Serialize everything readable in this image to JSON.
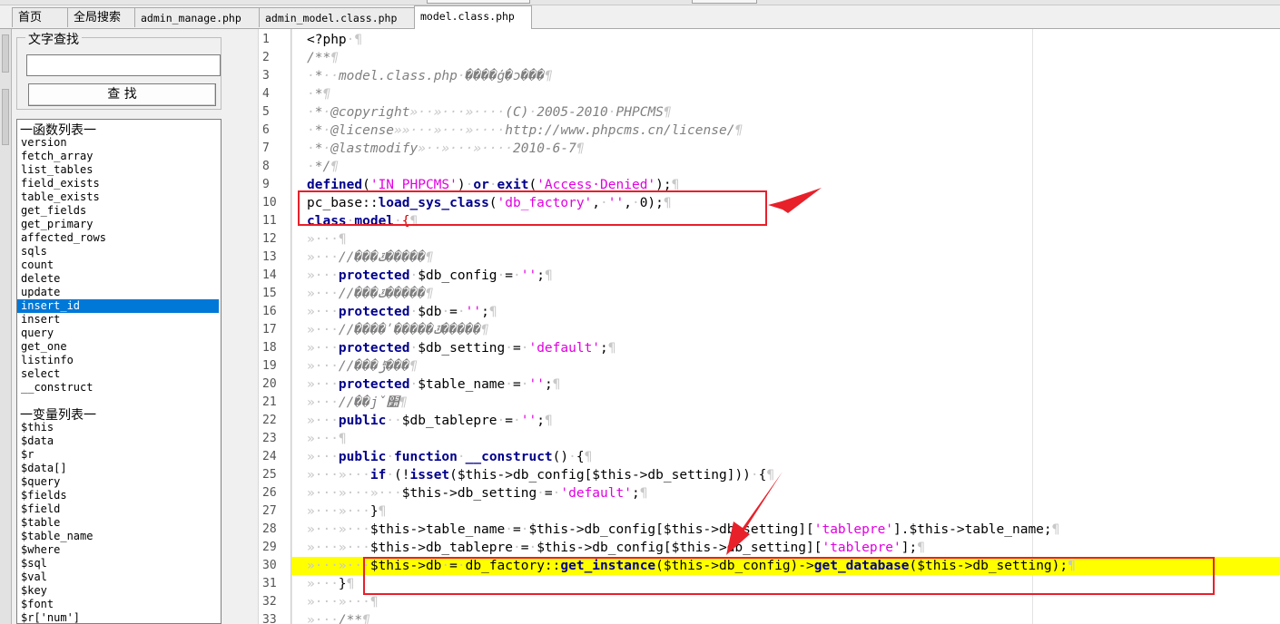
{
  "tabs": [
    {
      "label": "首页",
      "active": false
    },
    {
      "label": "全局搜索",
      "active": false
    },
    {
      "label": "admin_manage.php",
      "active": false
    },
    {
      "label": "admin_model.class.php",
      "active": false
    },
    {
      "label": "model.class.php",
      "active": true
    }
  ],
  "search": {
    "group_label": "文字查找",
    "input_value": "",
    "button_label": "查 找"
  },
  "functions": {
    "header": "一函数列表一",
    "items": [
      "version",
      "fetch_array",
      "list_tables",
      "field_exists",
      "table_exists",
      "get_fields",
      "get_primary",
      "affected_rows",
      "sqls",
      "count",
      "delete",
      "update",
      "insert_id",
      "insert",
      "query",
      "get_one",
      "listinfo",
      "select",
      "__construct"
    ],
    "selected": "insert_id"
  },
  "variables": {
    "header": "一变量列表一",
    "items": [
      "$this",
      "$data",
      "$r",
      "$data[]",
      "$query",
      "$fields",
      "$field",
      "$table",
      "$table_name",
      "$where",
      "$sql",
      "$val",
      "$key",
      "$font",
      "$r['num']"
    ]
  },
  "editor": {
    "line_numbers": [
      "1",
      "2",
      "3",
      "4",
      "5",
      "6",
      "7",
      "8",
      "9",
      "10",
      "11",
      "12",
      "13",
      "14",
      "15",
      "16",
      "17",
      "18",
      "19",
      "20",
      "21",
      "22",
      "23",
      "24",
      "25",
      "26",
      "27",
      "28",
      "29",
      "30",
      "31",
      "32",
      "33"
    ],
    "lines": [
      "<?php·¶",
      "/**¶",
      "·*··model.class.php·����ģ�ͻ���¶",
      "·*¶",
      "·*·@copyright»··»···»····(C)·2005-2010·PHPCMS¶",
      "·*·@license»»···»···»····http://www.phpcms.cn/license/¶",
      "·*·@lastmodify»··»···»····2010-6-7¶",
      "·*/¶",
      "defined('IN_PHPCMS')·or·exit('Access·Denied');¶",
      "pc_base::load_sys_class('db_factory',·'',·0);¶",
      "class·model·{¶",
      "»···¶",
      "»···//���ݿ�����¶",
      "»···protected·$db_config·=·'';¶",
      "»···//���ݿ�����¶",
      "»···protected·$db·=·'';¶",
      "»···//����ʹ�����ݿ�����¶",
      "»···protected·$db_setting·=·'default';¶",
      "»···//���ݱ���¶",
      "»···protected·$table_name·=·'';¶",
      "»···//��ǰ׺¶",
      "»···public··$db_tablepre·=·'';¶",
      "»···¶",
      "»···public·function·__construct()·{¶",
      "»···»···if·(!isset($this->db_config[$this->db_setting]))·{¶",
      "»···»···»···$this->db_setting·=·'default';¶",
      "»···»···}¶",
      "»···»···$this->table_name·=·$this->db_config[$this->db_setting]['tablepre'].$this->table_name;¶",
      "»···»···$this->db_tablepre·=·$this->db_config[$this->db_setting]['tablepre'];¶",
      "»···»···$this->db·=·db_factory::get_instance($this->db_config)->get_database($this->db_setting);¶",
      "»···}¶",
      "»···»···¶",
      "»···/**¶"
    ],
    "highlighted_line": "30"
  },
  "colors": {
    "keyword": "#00008b",
    "string": "#e100e1",
    "comment": "#808080",
    "highlight": "#ffff00",
    "annotation": "#e8202a",
    "selection": "#0078d7"
  }
}
